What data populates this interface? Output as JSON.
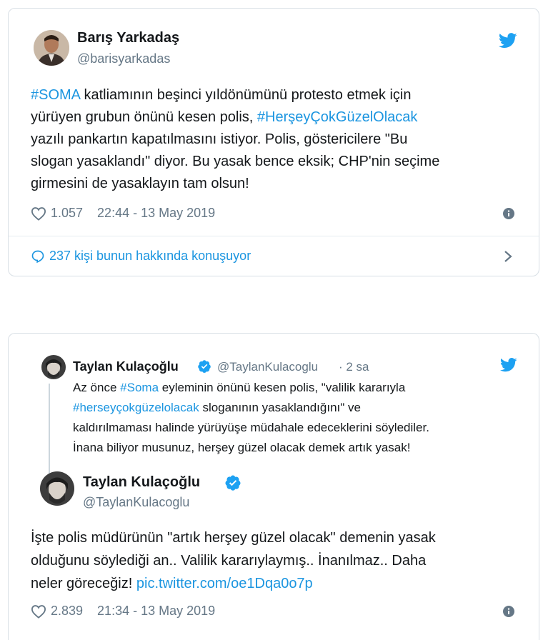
{
  "tweet1": {
    "name": "Barış Yarkadaş",
    "handle": "@barisyarkadas",
    "lines": [
      {
        "tag": "#SOMA",
        "text": " katliamının beşinci yıldönümünü protesto etmek için"
      },
      {
        "text": "yürüyen grubun önünü kesen polis, ",
        "tag2": "#HerşeyÇokGüzelOlacak"
      },
      {
        "text": "yazılı pankartın kapatılmasını istiyor. Polis, göstericilere  \"Bu"
      },
      {
        "text": "slogan yasaklandı\" diyor. Bu yasak bence eksik; CHP'nin seçime"
      },
      {
        "text": "girmesini de yasaklayın tam olsun!"
      }
    ],
    "likes": "1.057",
    "timestamp": "22:44 - 13 May 2019",
    "conversation": "237 kişi bunun hakkında konuşuyor"
  },
  "tweet2": {
    "quoted": {
      "name": "Taylan Kulaçoğlu",
      "handle": "@TaylanKulacoglu",
      "age": "· 2 sa",
      "lines": [
        {
          "text": "Az önce ",
          "tag": "#Soma",
          "rest": " eyleminin önünü kesen polis, \"valilik kararıyla"
        },
        {
          "tag": "#herseyçokgüzelolacak",
          "rest": " sloganının yasaklandığını\" ve"
        },
        {
          "text": "kaldırılmaması halinde yürüyüşe müdahale edeceklerini söylediler."
        },
        {
          "text": "İnana biliyor musunuz, herşey güzel olacak demek artık yasak!"
        }
      ]
    },
    "name": "Taylan Kulaçoğlu",
    "handle": "@TaylanKulacoglu",
    "lines": [
      {
        "text": "İşte polis müdürünün \"artık herşey güzel olacak\" demenin yasak"
      },
      {
        "text": "olduğunu söylediği an.. Valilik kararıylaymış.. İnanılmaz.. Daha"
      },
      {
        "text": "neler göreceğiz! ",
        "link": "pic.twitter.com/oe1Dqa0o7p"
      }
    ],
    "likes": "2.839",
    "timestamp": "21:34 - 13 May 2019"
  },
  "colors": {
    "accent": "#1b95e0",
    "text": "#14171a",
    "muted": "#657786",
    "border": "#d8dfe5"
  },
  "icons": [
    "twitter-bird-icon",
    "heart-icon",
    "info-icon",
    "speech-bubble-icon",
    "chevron-right-icon",
    "verified-badge-icon"
  ]
}
